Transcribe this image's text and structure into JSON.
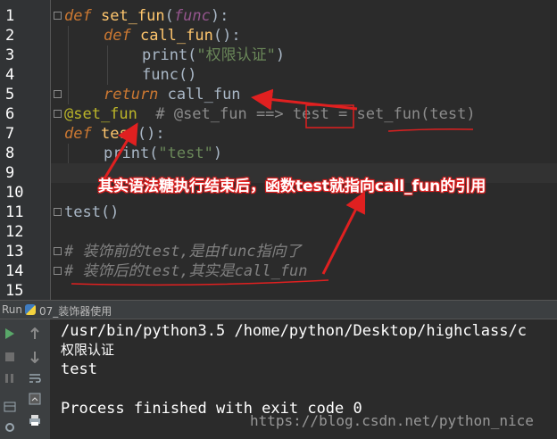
{
  "editor": {
    "line_numbers": [
      "1",
      "2",
      "3",
      "4",
      "5",
      "6",
      "7",
      "8",
      "9",
      "10",
      "11",
      "12",
      "13",
      "14",
      "15"
    ],
    "line1": {
      "kw": "def",
      "name": "set_fun",
      "open": "(",
      "param": "func",
      "close": "):"
    },
    "line2": {
      "kw": "def",
      "name": "call_fun",
      "rest": "():"
    },
    "line3": {
      "call": "print(",
      "str": "\"权限认证\"",
      "close": ")"
    },
    "line4": {
      "text": "func()"
    },
    "line5": {
      "kw": "return",
      "rest": " call_fun"
    },
    "line6": {
      "dec": "@set_fun",
      "comment": "  # @set_fun ==> test = set_fun(test)"
    },
    "line7": {
      "kw": "def",
      "name": "test",
      "rest": "():"
    },
    "line8": {
      "call": "print(",
      "str": "\"test\"",
      "close": ")"
    },
    "line11": {
      "text": "test()"
    },
    "line13": {
      "comment": "# 装饰前的test,是由func指向了"
    },
    "line14": {
      "comment": "# 装饰后的test,其实是call_fun"
    }
  },
  "run_bar": {
    "label": "Run",
    "title": "07_装饰器使用"
  },
  "console": {
    "lines": [
      "/usr/bin/python3.5 /home/python/Desktop/highclass/c",
      "权限认证",
      "test",
      "",
      "Process finished with exit code 0"
    ]
  },
  "annotation": {
    "text": "其实语法糖执行结束后，函数test就指向call_fun的引用",
    "color": "#e02020"
  },
  "watermark": "https://blog.csdn.net/python_nice",
  "colors": {
    "keyword": "#cc7832",
    "function": "#ffc66d",
    "string": "#6a8759",
    "comment": "#808080",
    "decorator": "#bbb529",
    "param": "#94558d",
    "annotation": "#e02020"
  }
}
